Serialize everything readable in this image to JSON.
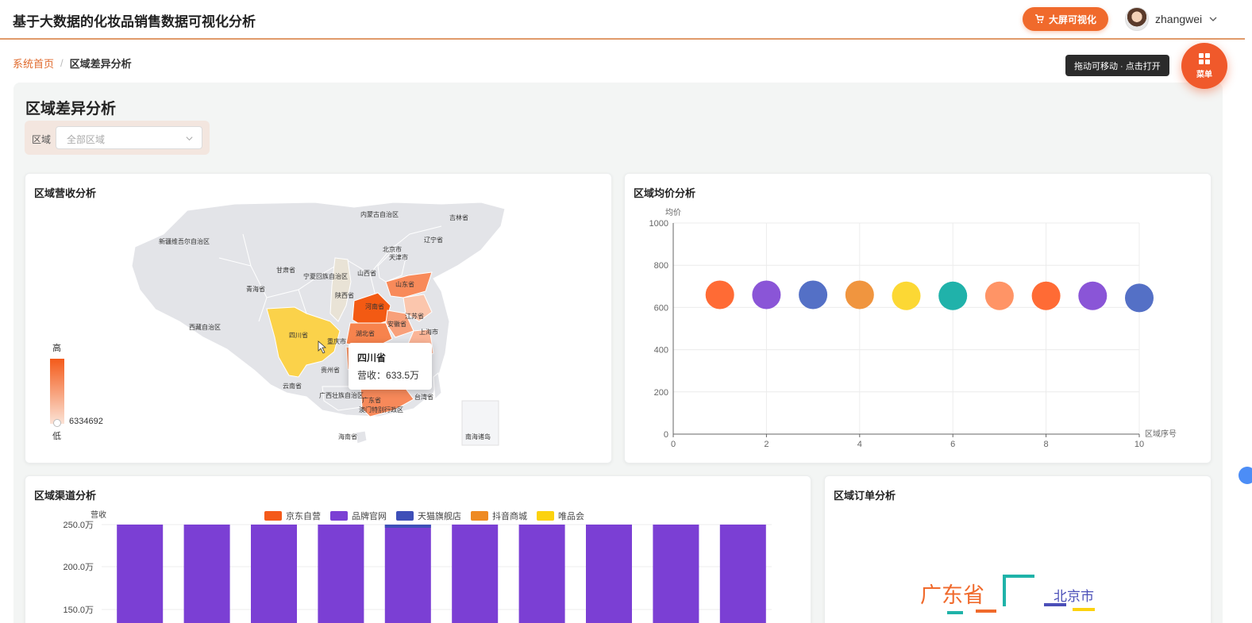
{
  "header": {
    "app_title": "基于大数据的化妆品销售数据可视化分析",
    "bigscreen_label": "大屏可视化",
    "username": "zhangwei"
  },
  "breadcrumb": {
    "home": "系统首页",
    "separator": "/",
    "current": "区域差异分析"
  },
  "floating_menu": {
    "hint": "拖动可移动 · 点击打开",
    "label": "菜单"
  },
  "page": {
    "title": "区域差异分析",
    "filter": {
      "label": "区域",
      "placeholder": "全部区域"
    }
  },
  "map_card": {
    "title": "区域营收分析",
    "legend_high": "高",
    "legend_low": "低",
    "legend_value": "6334692",
    "tooltip": {
      "title": "四川省",
      "label": "营收：",
      "value": "633.5万"
    },
    "region_labels": [
      "内蒙古自治区",
      "吉林省",
      "新疆维吾尔自治区",
      "辽宁省",
      "北京市",
      "天津市",
      "甘肃省",
      "宁夏回族自治区",
      "山西省",
      "青海省",
      "陕西省",
      "山东省",
      "河南省",
      "江苏省",
      "安徽省",
      "湖北省",
      "上海市",
      "西藏自治区",
      "四川省",
      "重庆市",
      "贵州省",
      "云南省",
      "广西壮族自治区",
      "广东省",
      "澳门特别行政区",
      "台湾省",
      "海南省",
      "南海诸岛"
    ]
  },
  "price_card": {
    "title": "区域均价分析"
  },
  "channel_card": {
    "title": "区域渠道分析"
  },
  "orders_card": {
    "title": "区域订单分析",
    "words": [
      "广东省",
      "北京市"
    ]
  },
  "colors": {
    "accent": "#f06a2c",
    "map_high": "#f45a1a",
    "map_sichuan": "#fbd24a"
  },
  "chart_data": [
    {
      "type": "scatter",
      "xlabel": "区域序号",
      "ylabel": "均价",
      "xlim": [
        0,
        10
      ],
      "ylim": [
        0,
        1000
      ],
      "x_ticks": [
        0,
        2,
        4,
        6,
        8,
        10
      ],
      "y_ticks": [
        0,
        200,
        400,
        600,
        800,
        1000
      ],
      "grid": true,
      "points": [
        {
          "x": 1,
          "y": 660,
          "color": "#ff6b35"
        },
        {
          "x": 2,
          "y": 660,
          "color": "#8a55d7"
        },
        {
          "x": 3,
          "y": 660,
          "color": "#5470c6"
        },
        {
          "x": 4,
          "y": 660,
          "color": "#f0953f"
        },
        {
          "x": 5,
          "y": 655,
          "color": "#fcd834"
        },
        {
          "x": 6,
          "y": 655,
          "color": "#20b2aa"
        },
        {
          "x": 7,
          "y": 655,
          "color": "#ff9466"
        },
        {
          "x": 8,
          "y": 655,
          "color": "#ff6b35"
        },
        {
          "x": 9,
          "y": 655,
          "color": "#8a55d7"
        },
        {
          "x": 10,
          "y": 645,
          "color": "#5470c6"
        }
      ]
    },
    {
      "type": "bar",
      "ylabel": "营收",
      "y_ticks": [
        "250.0万",
        "200.0万",
        "150.0万"
      ],
      "legend_position": "top",
      "series": [
        {
          "name": "京东自营",
          "color": "#f45a1a"
        },
        {
          "name": "品牌官网",
          "color": "#7b3fd4"
        },
        {
          "name": "天猫旗舰店",
          "color": "#3e4fb8"
        },
        {
          "name": "抖音商城",
          "color": "#ee8a23"
        },
        {
          "name": "唯品会",
          "color": "#fcd20f"
        }
      ],
      "bar_count": 10,
      "note_values_above": 250
    }
  ]
}
